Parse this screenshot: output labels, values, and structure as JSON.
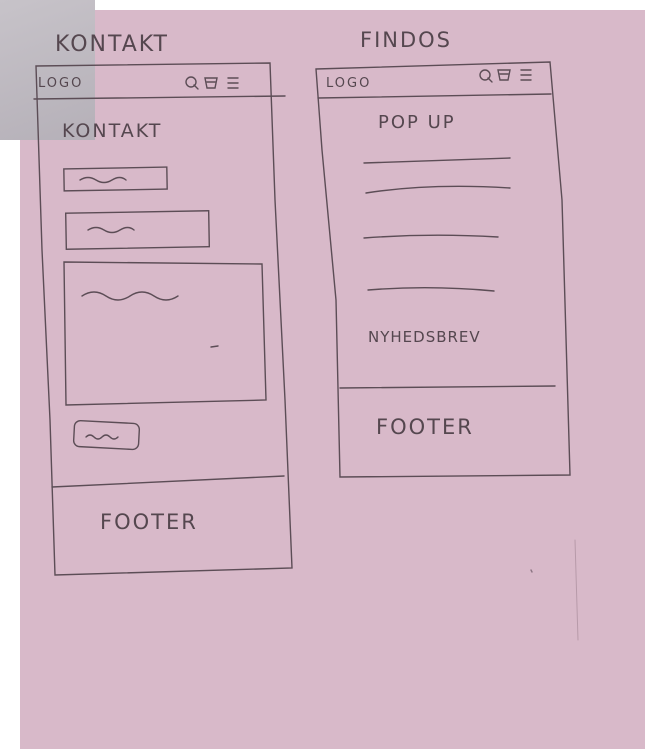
{
  "colors": {
    "paper": "#d8b9c9",
    "ink": "#55474f",
    "scrap": "#bdb8c0"
  },
  "left_sketch": {
    "title": "KONTAKT",
    "header_logo": "LOGO",
    "header_icons": [
      "search-icon",
      "cart-icon",
      "menu-icon"
    ],
    "heading": "KONTAKT",
    "footer": "FOOTER"
  },
  "right_sketch": {
    "title": "FINDOS",
    "header_logo": "LOGO",
    "header_icons": [
      "search-icon",
      "cart-icon",
      "menu-icon"
    ],
    "popup": "POP UP",
    "newsletter": "NYHEDSBREV",
    "footer": "FOOTER"
  }
}
